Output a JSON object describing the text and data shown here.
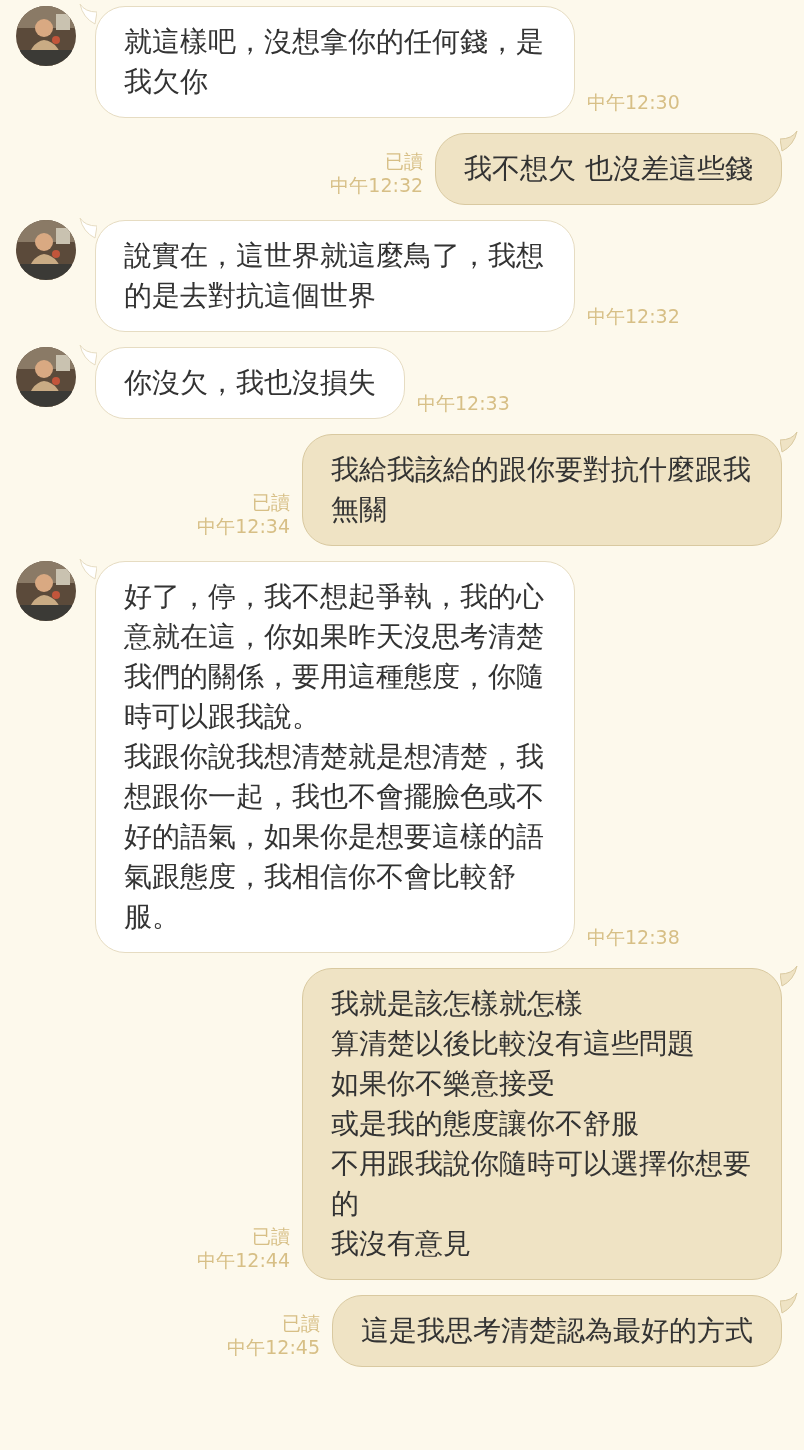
{
  "messages": [
    {
      "kind": "incoming",
      "paragraphs": [
        "就這樣吧，沒想拿你的任何錢，是我欠你"
      ],
      "time": "中午12:30"
    },
    {
      "kind": "outgoing",
      "read": "已讀",
      "paragraphs": [
        "我不想欠 也沒差這些錢"
      ],
      "time": "中午12:32"
    },
    {
      "kind": "incoming",
      "paragraphs": [
        "說實在，這世界就這麼鳥了，我想的是去對抗這個世界"
      ],
      "time": "中午12:32"
    },
    {
      "kind": "incoming",
      "paragraphs": [
        "你沒欠，我也沒損失"
      ],
      "time": "中午12:33"
    },
    {
      "kind": "outgoing",
      "read": "已讀",
      "paragraphs": [
        "我給我該給的跟你要對抗什麼跟我無關"
      ],
      "time": "中午12:34"
    },
    {
      "kind": "incoming",
      "paragraphs": [
        "好了，停，我不想起爭執，我的心意就在這，你如果昨天沒思考清楚我們的關係，要用這種態度，你隨時可以跟我說。",
        "我跟你說我想清楚就是想清楚，我想跟你一起，我也不會擺臉色或不好的語氣，如果你是想要這樣的語氣跟態度，我相信你不會比較舒服。"
      ],
      "time": "中午12:38"
    },
    {
      "kind": "outgoing",
      "read": "已讀",
      "lines": [
        "我就是該怎樣就怎樣",
        "算清楚以後比較沒有這些問題",
        "如果你不樂意接受",
        "或是我的態度讓你不舒服",
        "不用跟我說你隨時可以選擇你想要的",
        "我沒有意見"
      ],
      "time": "中午12:44"
    },
    {
      "kind": "outgoing",
      "read": "已讀",
      "paragraphs": [
        "這是我思考清楚認為最好的方式"
      ],
      "time": "中午12:45"
    }
  ]
}
